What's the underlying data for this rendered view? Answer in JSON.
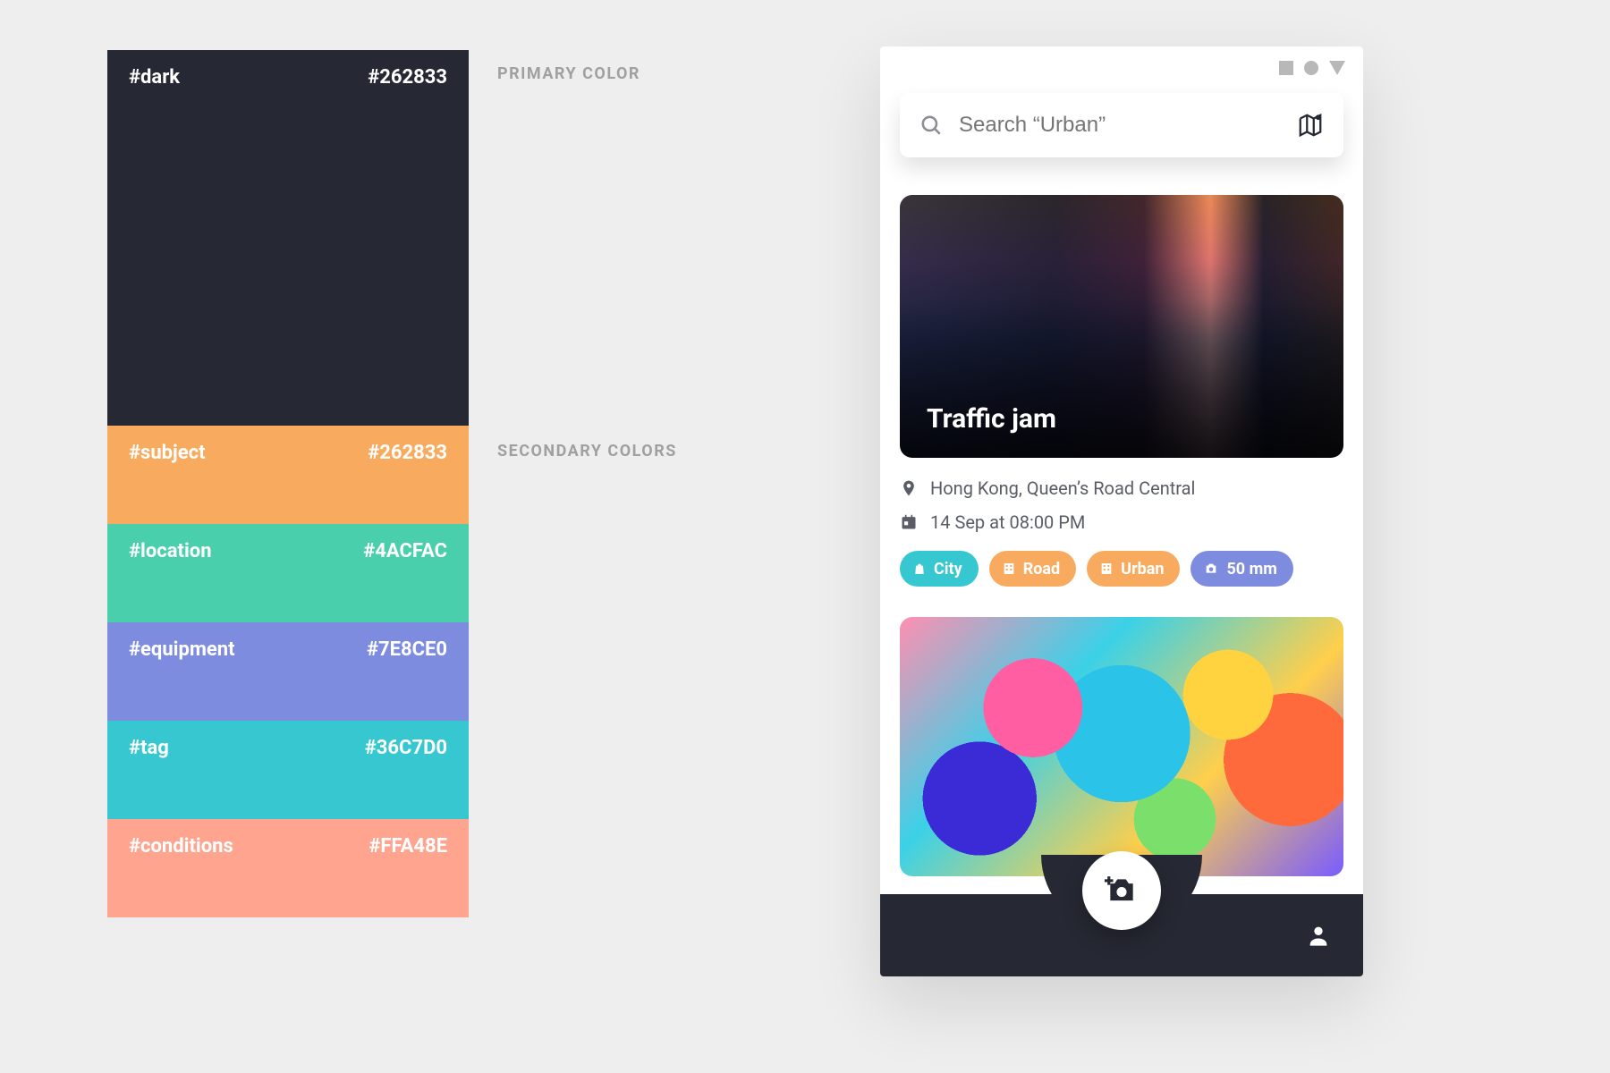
{
  "palette": {
    "primary_label": "PRIMARY COLOR",
    "secondary_label": "SECONDARY COLORS",
    "swatches": [
      {
        "name": "#dark",
        "hex": "#262833"
      },
      {
        "name": "#subject",
        "hex": "#262833"
      },
      {
        "name": "#location",
        "hex": "#4ACFAC"
      },
      {
        "name": "#equipment",
        "hex": "#7E8CE0"
      },
      {
        "name": "#tag",
        "hex": "#36C7D0"
      },
      {
        "name": "#conditions",
        "hex": "#FFA48E"
      }
    ]
  },
  "search": {
    "placeholder": "Search “Urban”"
  },
  "card": {
    "title": "Traffic jam",
    "location": "Hong Kong, Queen’s Road Central",
    "datetime": "14 Sep at 08:00 PM"
  },
  "chips": {
    "city": "City",
    "road": "Road",
    "urban": "Urban",
    "lens": "50 mm"
  }
}
